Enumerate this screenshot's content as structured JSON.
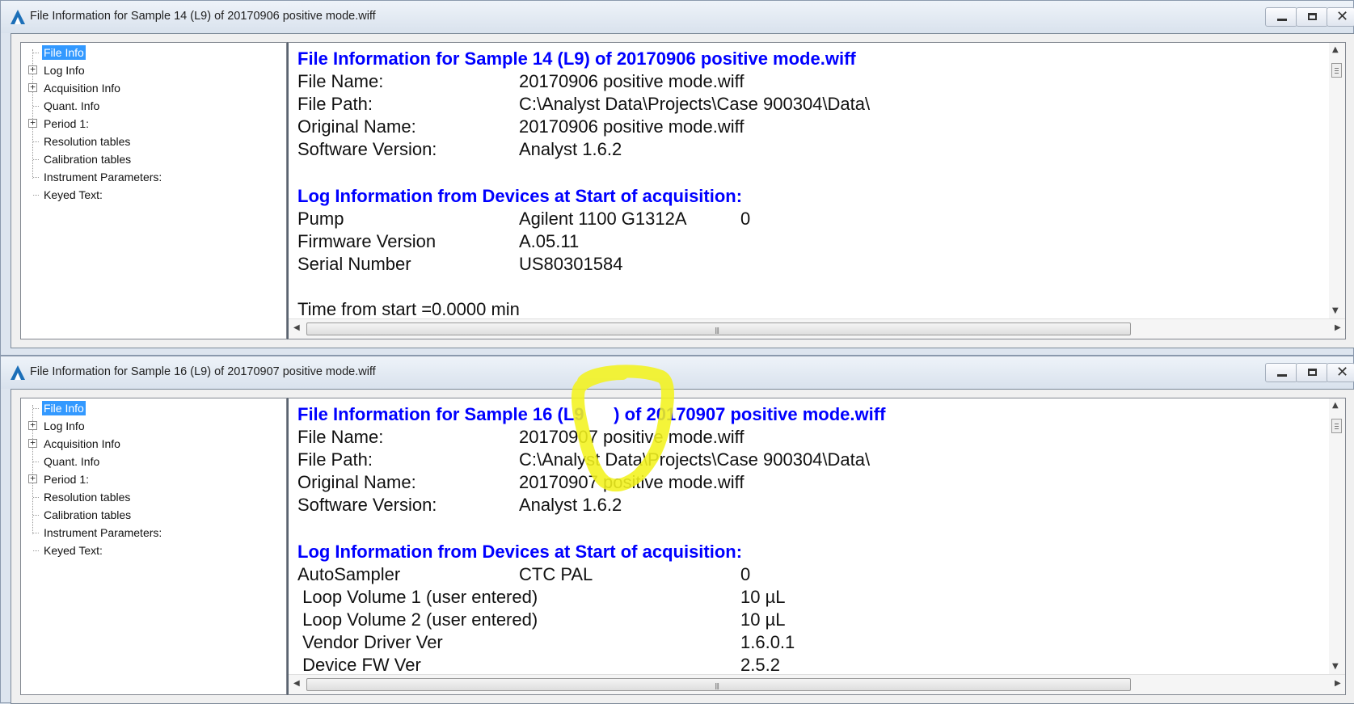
{
  "windows": [
    {
      "title": "File Information for Sample 14 (L9) of 20170906 positive mode.wiff",
      "tree": [
        "File Info",
        "Log Info",
        "Acquisition Info",
        "Quant. Info",
        "Period 1:",
        "Resolution tables",
        "Calibration tables",
        "Instrument Parameters:",
        "Keyed Text:"
      ],
      "heading1": "File Information for Sample 14 (L9) of 20170906 positive mode.wiff",
      "fields": [
        {
          "label": "File Name:",
          "value": "20170906 positive mode.wiff"
        },
        {
          "label": "File Path:",
          "value": "C:\\Analyst Data\\Projects\\Case 900304\\Data\\"
        },
        {
          "label": "Original Name:",
          "value": "20170906 positive mode.wiff"
        },
        {
          "label": "Software Version:",
          "value": "Analyst 1.6.2"
        }
      ],
      "heading2": "Log Information from Devices at Start of acquisition:",
      "log": [
        {
          "label": "Pump",
          "value": "Agilent 1100 G1312A",
          "extra": "0"
        },
        {
          "label": "Firmware Version",
          "value": "A.05.11",
          "extra": ""
        },
        {
          "label": "Serial Number",
          "value": "US80301584",
          "extra": ""
        }
      ],
      "footer": "Time from start =0.0000 min"
    },
    {
      "title": "File Information for Sample 16 (L9) of 20170907 positive mode.wiff",
      "tree": [
        "File Info",
        "Log Info",
        "Acquisition Info",
        "Quant. Info",
        "Period 1:",
        "Resolution tables",
        "Calibration tables",
        "Instrument Parameters:",
        "Keyed Text:"
      ],
      "heading1": "File Information for Sample 16 (L9      ) of 20170907 positive mode.wiff",
      "fields": [
        {
          "label": "File Name:",
          "value": "20170907 positive mode.wiff"
        },
        {
          "label": "File Path:",
          "value": "C:\\Analyst Data\\Projects\\Case 900304\\Data\\"
        },
        {
          "label": "Original Name:",
          "value": "20170907 positive mode.wiff"
        },
        {
          "label": "Software Version:",
          "value": "Analyst 1.6.2"
        }
      ],
      "heading2": "Log Information from Devices at Start of acquisition:",
      "log": [
        {
          "label": "AutoSampler",
          "value": "CTC PAL",
          "extra": "0"
        },
        {
          "label": " Loop Volume 1 (user entered)",
          "value": "",
          "extra": "10 µL"
        },
        {
          "label": " Loop Volume 2 (user entered)",
          "value": "",
          "extra": "10 µL"
        },
        {
          "label": " Vendor Driver Ver",
          "value": "",
          "extra": "1.6.0.1"
        },
        {
          "label": " Device FW Ver",
          "value": "",
          "extra": "2.5.2"
        }
      ],
      "footer": ""
    }
  ],
  "colors": {
    "heading": "#0000ff",
    "highlight": "#f2f21e",
    "selection": "#3399ff"
  },
  "icons": [
    "app-logo-icon",
    "minimize-icon",
    "maximize-icon",
    "close-icon",
    "expand-plus-icon",
    "scroll-up-icon",
    "scroll-down-icon",
    "scroll-left-icon",
    "scroll-right-icon"
  ]
}
